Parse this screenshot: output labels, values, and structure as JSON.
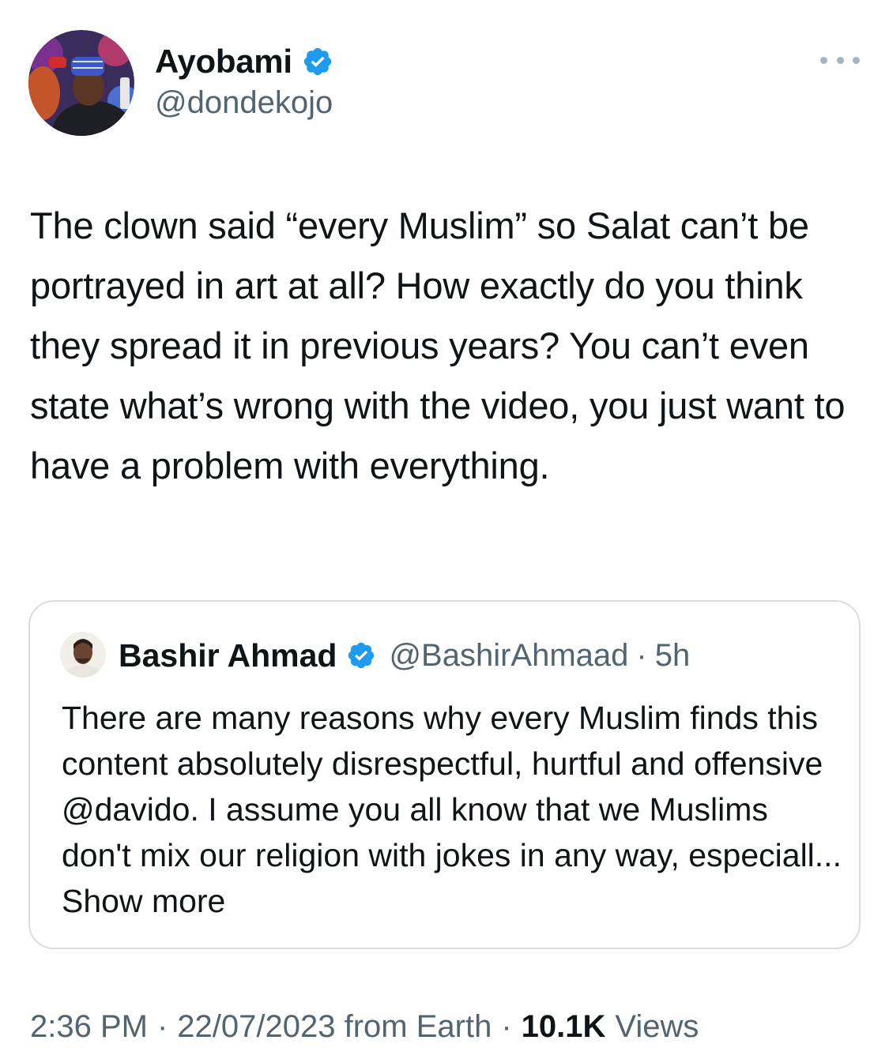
{
  "author": {
    "display_name": "Ayobami",
    "handle": "@dondekojo",
    "verified": true
  },
  "more_menu": {
    "icon": "more-horizontal-icon"
  },
  "tweet": {
    "text": "The clown said “every Muslim” so Salat can’t be portrayed in art at all? How exactly do you think they spread it in previous years? You can’t even state what’s wrong with the video, you just want to have a problem with everything."
  },
  "quoted_tweet": {
    "display_name": "Bashir Ahmad",
    "handle": "@BashirAhmaad",
    "separator": "·",
    "time": "5h",
    "verified": true,
    "text": "There are many reasons why every Muslim finds this content absolutely disrespectful, hurtful and offensive @davido. I assume you all know that we Muslims don't mix our religion with jokes in any way, especiall...",
    "show_more": "Show more"
  },
  "meta": {
    "time": "2:36 PM",
    "separator": "·",
    "date_source": "22/07/2023 from Earth",
    "views_count": "10.1K",
    "views_label": "Views"
  },
  "colors": {
    "verified_blue": "#1d9bf0",
    "secondary_text": "#536471",
    "border": "#d7dde2"
  }
}
